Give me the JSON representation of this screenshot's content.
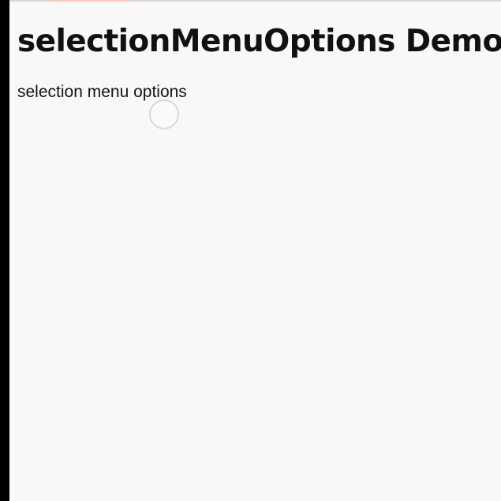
{
  "page": {
    "title": "selectionMenuOptions Demo",
    "body_text": "selection menu options"
  },
  "colors": {
    "background": "#f8f8f8",
    "text": "#111111",
    "left_bezel": "#000000"
  }
}
